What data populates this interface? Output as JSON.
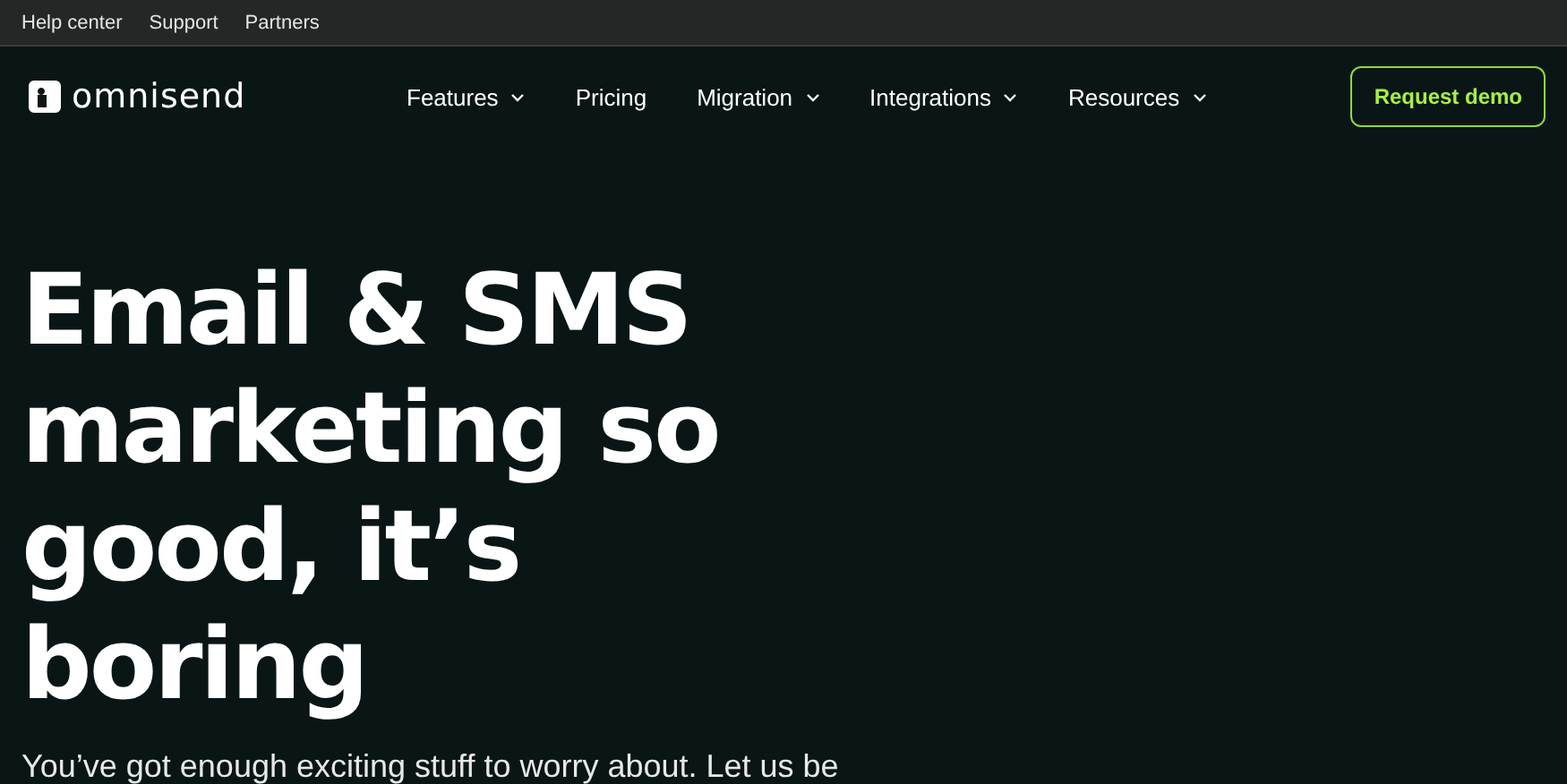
{
  "top_links": [
    "Help center",
    "Support",
    "Partners"
  ],
  "logo": {
    "text": "omnisend"
  },
  "nav": [
    {
      "label": "Features",
      "has_menu": true
    },
    {
      "label": "Pricing",
      "has_menu": false
    },
    {
      "label": "Migration",
      "has_menu": true
    },
    {
      "label": "Integrations",
      "has_menu": true
    },
    {
      "label": "Resources",
      "has_menu": true
    }
  ],
  "cta": "Request demo",
  "hero": {
    "headline_lines": [
      "Email & SMS",
      "marketing so",
      "good, it’s",
      "boring"
    ],
    "subtitle": "You’ve got enough exciting stuff to worry about. Let us be"
  }
}
